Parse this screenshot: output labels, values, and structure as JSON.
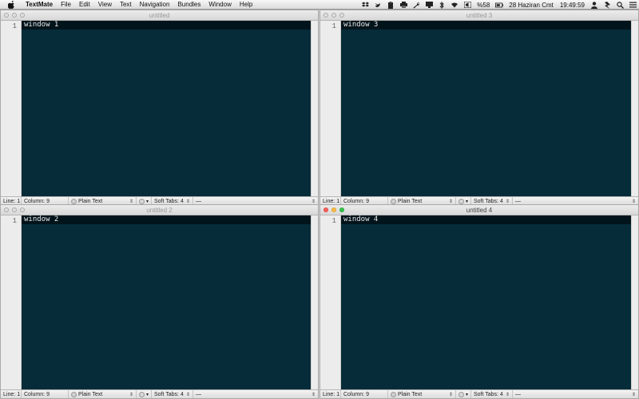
{
  "menubar": {
    "app_name": "TextMate",
    "menus": [
      "File",
      "Edit",
      "View",
      "Text",
      "Navigation",
      "Bundles",
      "Window",
      "Help"
    ],
    "status": {
      "battery": "%58",
      "date": "28 Haziran Cmt",
      "time": "19:49:59"
    },
    "icons": [
      "dropbox-icon",
      "bird-icon",
      "clipboard-icon",
      "printer-icon",
      "wrench-icon",
      "display-icon",
      "bluetooth-icon",
      "wifi-icon",
      "volume-icon",
      "battery-icon",
      "user-icon",
      "app-icon",
      "spotlight-icon",
      "list-icon"
    ]
  },
  "windows": [
    {
      "title": "untitled",
      "line_number": "1",
      "content": "window 1",
      "active": false,
      "status": {
        "line_label": "Line:",
        "line": "1",
        "column_label": "Column:",
        "column": "9",
        "grammar": "Plain Text",
        "tabs_label": "Soft Tabs:",
        "tabs": "4",
        "symbol": "—"
      }
    },
    {
      "title": "untitled 3",
      "line_number": "1",
      "content": "window 3",
      "active": false,
      "status": {
        "line_label": "Line:",
        "line": "1",
        "column_label": "Column:",
        "column": "9",
        "grammar": "Plain Text",
        "tabs_label": "Soft Tabs:",
        "tabs": "4",
        "symbol": "—"
      }
    },
    {
      "title": "untitled 2",
      "line_number": "1",
      "content": "window 2",
      "active": false,
      "status": {
        "line_label": "Line:",
        "line": "1",
        "column_label": "Column:",
        "column": "9",
        "grammar": "Plain Text",
        "tabs_label": "Soft Tabs:",
        "tabs": "4",
        "symbol": "—"
      }
    },
    {
      "title": "untitled 4",
      "line_number": "1",
      "content": "window 4",
      "active": true,
      "status": {
        "line_label": "Line:",
        "line": "1",
        "column_label": "Column:",
        "column": "9",
        "grammar": "Plain Text",
        "tabs_label": "Soft Tabs:",
        "tabs": "4",
        "symbol": "—"
      }
    }
  ],
  "colors": {
    "editor_bg": "#062c39",
    "current_line": "#02141b",
    "text": "#e8e8e8",
    "close": "#fc605b",
    "minimize": "#fdbc40",
    "zoom": "#34c84a"
  }
}
